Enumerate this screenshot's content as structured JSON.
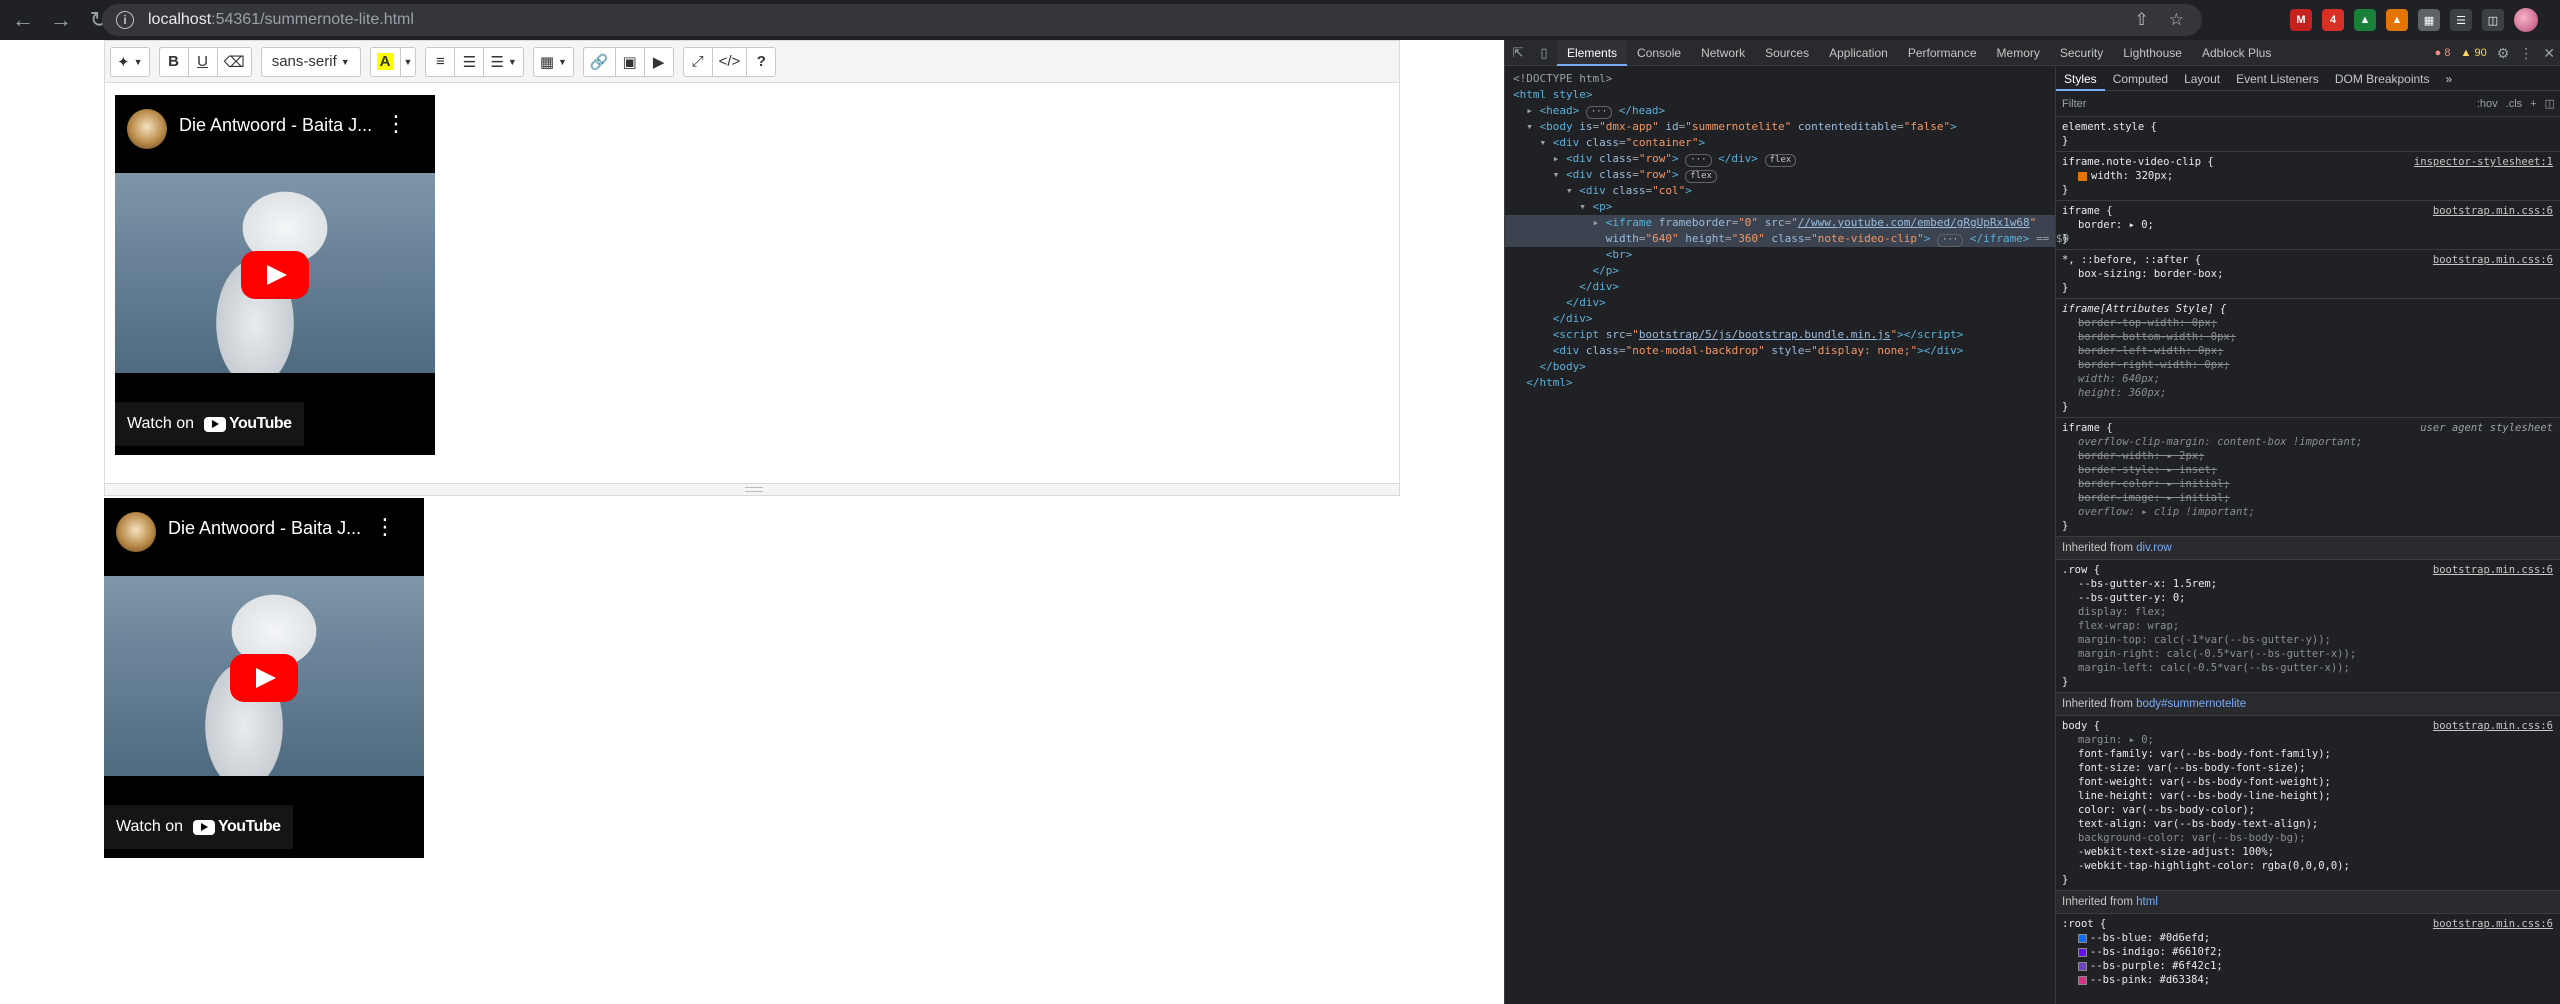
{
  "browser": {
    "url_host": "localhost",
    "url_path": ":54361/summernote-lite.html",
    "badge_count": "4"
  },
  "editor": {
    "toolbar": {
      "font_name": "sans-serif"
    }
  },
  "videos": [
    {
      "title": "Die Antwoord - Baita J...",
      "watch_label": "Watch on",
      "yt_brand": "YouTube"
    },
    {
      "title": "Die Antwoord - Baita J...",
      "watch_label": "Watch on",
      "yt_brand": "YouTube"
    }
  ],
  "devtools": {
    "tabs": [
      "Elements",
      "Console",
      "Network",
      "Sources",
      "Application",
      "Performance",
      "Memory",
      "Security",
      "Lighthouse",
      "Adblock Plus"
    ],
    "active_tab": "Elements",
    "errors": "8",
    "warnings": "90",
    "styles_tabs": [
      "Styles",
      "Computed",
      "Layout",
      "Event Listeners",
      "DOM Breakpoints"
    ],
    "filter_placeholder": "Filter",
    "filter_hov": ":hov",
    "filter_cls": ".cls",
    "dom": {
      "doctype": "<!DOCTYPE html>",
      "html_open": "<html style>",
      "head": "<head>",
      "head_close": "</head>",
      "body_tag": "body",
      "body_is": "dmx-app",
      "body_id": "summernotelite",
      "body_ce": "false",
      "container": "container",
      "row": "row",
      "col": "col",
      "iframe_src": "//www.youtube.com/embed/gRgUpRx1w68",
      "iframe_width": "640",
      "iframe_height": "360",
      "iframe_class": "note-video-clip",
      "dollar0": "== $0",
      "script_src": "bootstrap/5/js/bootstrap.bundle.min.js",
      "backdrop_class": "note-modal-backdrop",
      "backdrop_style": "display: none;",
      "flex": "flex"
    },
    "rules": {
      "element_style": "element.style {",
      "r1_sel": "iframe.note-video-clip {",
      "r1_src": "inspector-stylesheet:1",
      "r1_decl": "width: 320px;",
      "r2_sel": "iframe {",
      "r2_src": "bootstrap.min.css:6",
      "r2_decl": "border: ▸ 0;",
      "r3_sel": "*, ::before, ::after {",
      "r3_src": "bootstrap.min.css:6",
      "r3_decl": "box-sizing: border-box;",
      "r4_sel": "iframe[Attributes Style] {",
      "r4_decls": [
        "border-top-width: 0px;",
        "border-bottom-width: 0px;",
        "border-left-width: 0px;",
        "border-right-width: 0px;"
      ],
      "r4_width": "width: 640px;",
      "r4_height": "height: 360px;",
      "r5_sel": "iframe {",
      "r5_src": "user agent stylesheet",
      "r5_first": "overflow-clip-margin: content-box !important;",
      "r5_decls": [
        "border-width: ▸ 2px;",
        "border-style: ▸ inset;",
        "border-color: ▸ initial;",
        "border-image: ▸ initial;"
      ],
      "r5_last": "overflow: ▸ clip !important;",
      "inh1_label": "Inherited from",
      "inh1_target": "div.row",
      "r6_sel": ".row {",
      "r6_src": "bootstrap.min.css:6",
      "r6_decls": [
        "--bs-gutter-x: 1.5rem;",
        "--bs-gutter-y: 0;",
        "display: flex;",
        "flex-wrap: wrap;",
        "margin-top: calc(-1*var(--bs-gutter-y));",
        "margin-right: calc(-0.5*var(--bs-gutter-x));",
        "margin-left: calc(-0.5*var(--bs-gutter-x));"
      ],
      "inh2_label": "Inherited from",
      "inh2_target": "body#summernotelite",
      "r7_sel": "body {",
      "r7_src": "bootstrap.min.css:6",
      "r7_decls": [
        "margin: ▸ 0;",
        "font-family: var(--bs-body-font-family);",
        "font-size: var(--bs-body-font-size);",
        "font-weight: var(--bs-body-font-weight);",
        "line-height: var(--bs-body-line-height);",
        "color: var(--bs-body-color);",
        "text-align: var(--bs-body-text-align);",
        "background-color: var(--bs-body-bg);",
        "-webkit-text-size-adjust: 100%;",
        "-webkit-tap-highlight-color: rgba(0,0,0,0);"
      ],
      "inh3_label": "Inherited from",
      "inh3_target": "html",
      "r8_sel": ":root {",
      "r8_src": "bootstrap.min.css:6",
      "r8_decls": [
        "--bs-blue: #0d6efd;",
        "--bs-indigo: #6610f2;",
        "--bs-purple: #6f42c1;",
        "--bs-pink: #d63384;"
      ],
      "r8_colors": [
        "#0d6efd",
        "#6610f2",
        "#6f42c1",
        "#d63384"
      ]
    }
  },
  "colors": {
    "chrome_bg": "#202124",
    "devtools_bg": "#202124",
    "yt_red": "#ff0000",
    "accent": "#7cacf8"
  }
}
